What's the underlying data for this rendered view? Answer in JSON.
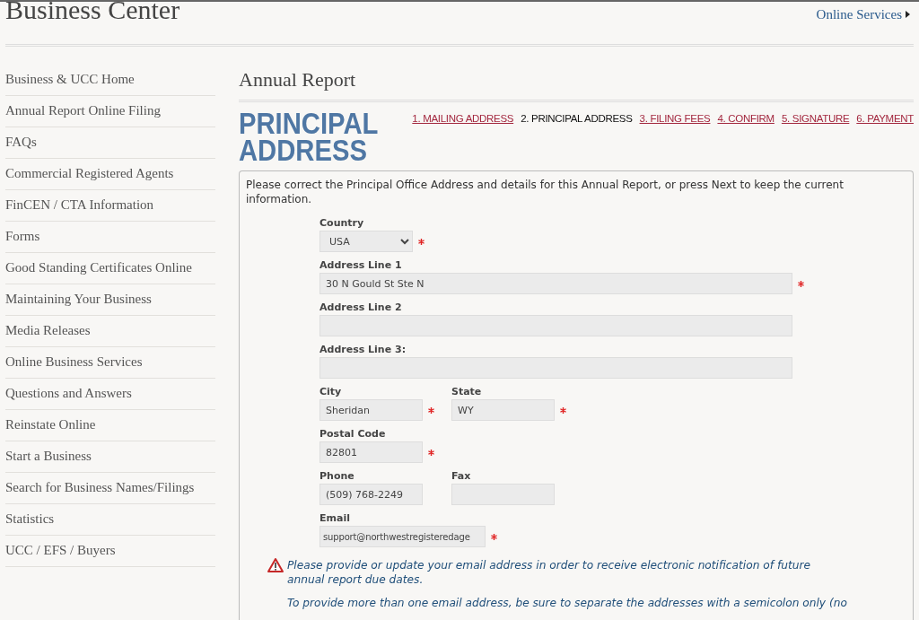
{
  "header": {
    "title": "Business Center",
    "online_services": "Online Services"
  },
  "sidebar": {
    "items": [
      {
        "label": "Business & UCC Home"
      },
      {
        "label": "Annual Report Online Filing"
      },
      {
        "label": "FAQs"
      },
      {
        "label": "Commercial Registered Agents"
      },
      {
        "label": "FinCEN / CTA Information"
      },
      {
        "label": "Forms"
      },
      {
        "label": "Good Standing Certificates Online"
      },
      {
        "label": "Maintaining Your Business"
      },
      {
        "label": "Media Releases"
      },
      {
        "label": "Online Business Services"
      },
      {
        "label": "Questions and Answers"
      },
      {
        "label": "Reinstate Online"
      },
      {
        "label": "Start a Business"
      },
      {
        "label": "Search for Business Names/Filings"
      },
      {
        "label": "Statistics"
      },
      {
        "label": "UCC / EFS / Buyers"
      }
    ]
  },
  "page_title": "Annual Report",
  "section_heading": "PRINCIPAL ADDRESS",
  "steps": [
    {
      "label": "1. MAILING ADDRESS",
      "selected": false
    },
    {
      "label": "2. PRINCIPAL ADDRESS",
      "selected": true
    },
    {
      "label": "3. FILING FEES",
      "selected": false
    },
    {
      "label": "4. CONFIRM",
      "selected": false
    },
    {
      "label": "5. SIGNATURE",
      "selected": false
    },
    {
      "label": "6. PAYMENT",
      "selected": false
    }
  ],
  "form": {
    "intro": "Please correct the Principal Office Address and details for this Annual Report, or press Next to keep the current information.",
    "rows": [
      [
        {
          "label": "Country",
          "kind": "select",
          "value": "USA",
          "required": true
        }
      ],
      [
        {
          "label": "Address Line 1",
          "kind": "long",
          "value": "30 N Gould St Ste N",
          "required": true
        }
      ],
      [
        {
          "label": "Address Line 2",
          "kind": "long",
          "required": false
        }
      ],
      [
        {
          "label": "Address Line 3:",
          "kind": "long",
          "required": false
        }
      ],
      [
        {
          "label": "City",
          "kind": "short",
          "value": "Sheridan",
          "required": true
        },
        {
          "label": "State",
          "kind": "short",
          "value": "WY",
          "required": true
        }
      ],
      [
        {
          "label": "Postal Code",
          "kind": "short",
          "value": "82801",
          "required": true
        }
      ],
      [
        {
          "label": "Phone",
          "kind": "short",
          "value": "(509) 768-2249",
          "required": false
        },
        {
          "label": "Fax",
          "kind": "short",
          "required": false
        }
      ],
      [
        {
          "label": "Email",
          "kind": "email",
          "value": "support@northwestregisteredage",
          "required": true
        }
      ]
    ],
    "notes": [
      "Please provide or update your email address in order to receive electronic notification of future annual report due dates.",
      "To provide more than one email address, be sure to separate the addresses with a semicolon only (no"
    ]
  }
}
